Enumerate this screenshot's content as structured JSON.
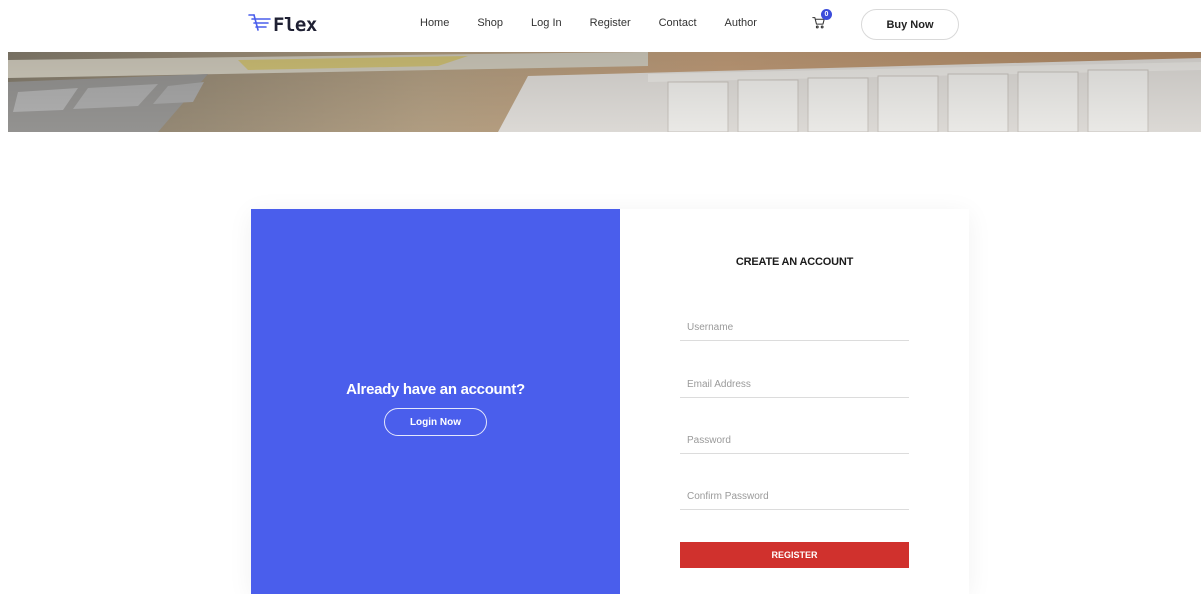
{
  "brand": {
    "name": "Flex"
  },
  "nav": {
    "items": [
      {
        "label": "Home"
      },
      {
        "label": "Shop"
      },
      {
        "label": "Log In"
      },
      {
        "label": "Register"
      },
      {
        "label": "Contact"
      },
      {
        "label": "Author"
      }
    ]
  },
  "cart": {
    "count": "0"
  },
  "header": {
    "buy_label": "Buy Now"
  },
  "colors": {
    "accent": "#4a5eec",
    "register": "#d0312d",
    "badge": "#3b4cdb"
  },
  "left_panel": {
    "title": "Already have an account?",
    "button_label": "Login Now"
  },
  "form": {
    "title": "CREATE AN ACCOUNT",
    "username_placeholder": "Username",
    "email_placeholder": "Email Address",
    "password_placeholder": "Password",
    "confirm_placeholder": "Confirm Password",
    "submit_label": "REGISTER"
  }
}
